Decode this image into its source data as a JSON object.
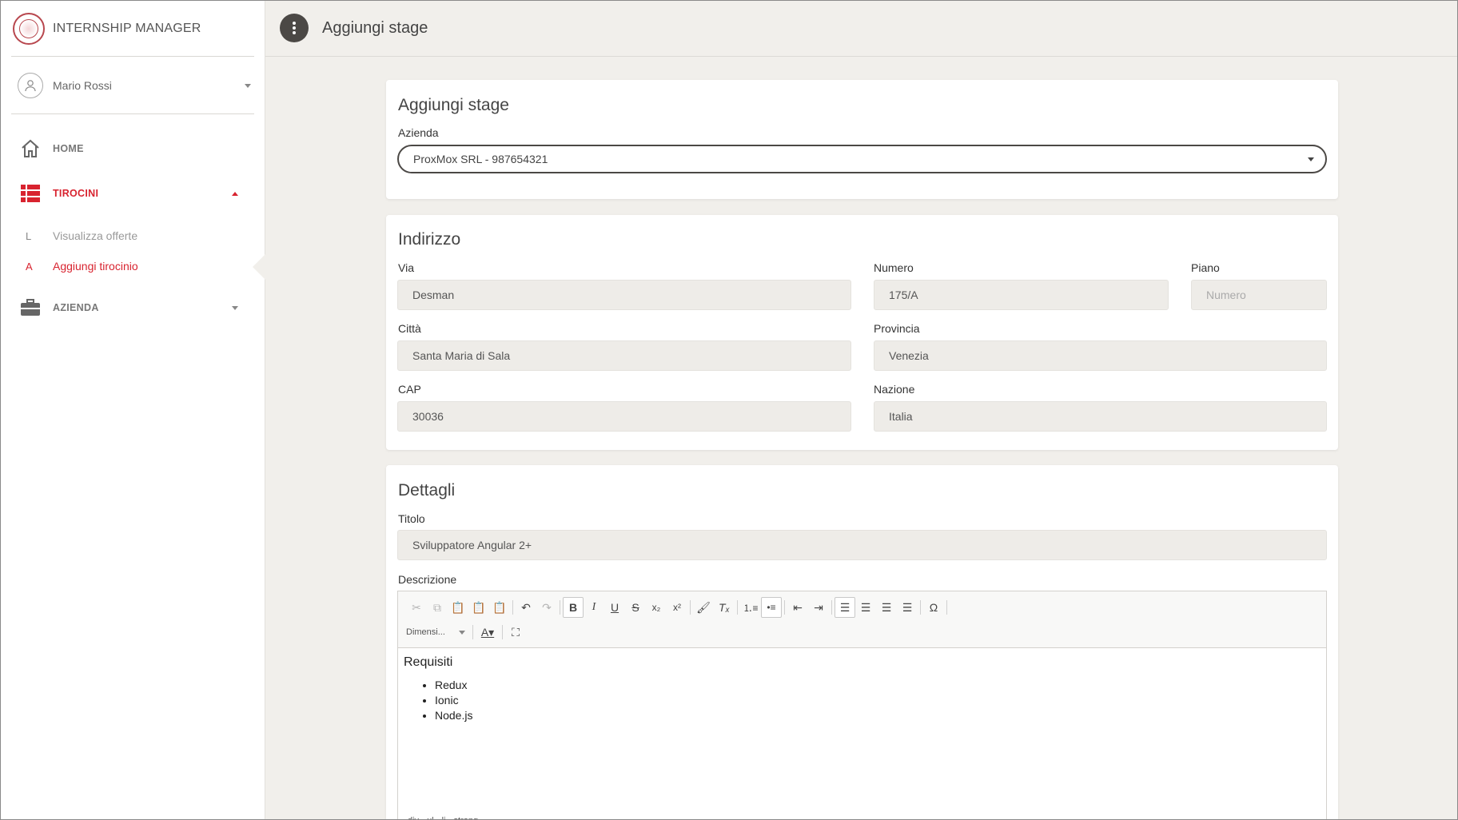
{
  "app": {
    "title": "INTERNSHIP MANAGER"
  },
  "user": {
    "name": "Mario Rossi"
  },
  "nav": {
    "home": "HOME",
    "tirocini": "TIROCINI",
    "azienda": "AZIENDA",
    "sub": [
      {
        "mini": "L",
        "label": "Visualizza offerte"
      },
      {
        "mini": "A",
        "label": "Aggiungi tirocinio"
      }
    ]
  },
  "header": {
    "title": "Aggiungi stage"
  },
  "form": {
    "section1": {
      "title": "Aggiungi stage",
      "azienda_label": "Azienda",
      "azienda_value": "ProxMox SRL - 987654321"
    },
    "address": {
      "title": "Indirizzo",
      "via_label": "Via",
      "via_value": "Desman",
      "numero_label": "Numero",
      "numero_value": "175/A",
      "piano_label": "Piano",
      "piano_placeholder": "Numero",
      "citta_label": "Città",
      "citta_value": "Santa Maria di Sala",
      "provincia_label": "Provincia",
      "provincia_value": "Venezia",
      "cap_label": "CAP",
      "cap_value": "30036",
      "nazione_label": "Nazione",
      "nazione_value": "Italia"
    },
    "details": {
      "title": "Dettagli",
      "titolo_label": "Titolo",
      "titolo_value": "Sviluppatore Angular 2+",
      "descrizione_label": "Descrizione"
    }
  },
  "editor": {
    "size_label": "Dimensi...",
    "heading": "Requisiti",
    "items": [
      "Redux",
      "Ionic",
      "Node.js"
    ],
    "path": [
      "div",
      "ul",
      "li",
      "strong"
    ]
  },
  "colors": {
    "accent": "#d8232f",
    "dark": "#4b4845",
    "field_bg": "#eeece8"
  }
}
